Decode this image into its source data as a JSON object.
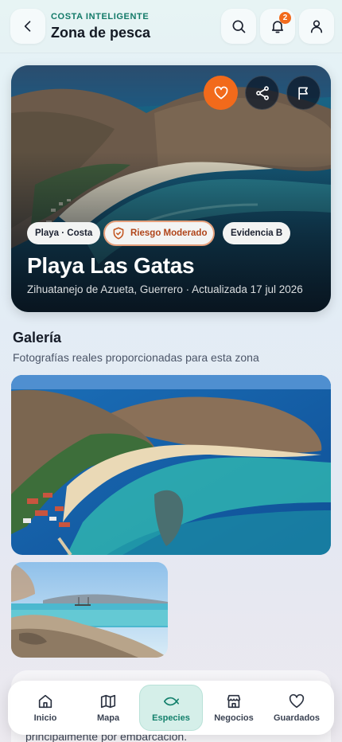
{
  "header": {
    "eyebrow": "COSTA INTELIGENTE",
    "title": "Zona de pesca",
    "notifications_count": "2",
    "icons": [
      "chevron-left-icon",
      "search-icon",
      "bell-icon",
      "user-icon"
    ]
  },
  "hero": {
    "chips": {
      "type": "Playa · Costa",
      "risk": "Riesgo Moderado",
      "evidence": "Evidencia B"
    },
    "title": "Playa Las Gatas",
    "subtitle": "Zihuatanejo de Azueta, Guerrero · Actualizada 17 jul 2026",
    "actions": [
      "heart-icon",
      "share-icon",
      "flag-icon"
    ]
  },
  "gallery": {
    "title": "Galería",
    "subtitle": "Fotografías reales proporcionadas para esta zona"
  },
  "peek": {
    "text": "principalmente por embarcación."
  },
  "nav": {
    "items": [
      {
        "label": "Inicio",
        "icon": "home-icon"
      },
      {
        "label": "Mapa",
        "icon": "map-icon"
      },
      {
        "label": "Especies",
        "icon": "fish-icon",
        "active": true
      },
      {
        "label": "Negocios",
        "icon": "store-icon"
      },
      {
        "label": "Guardados",
        "icon": "heart-icon"
      }
    ]
  },
  "colors": {
    "accent": "#13806c",
    "orange": "#f26a1b",
    "risk_text": "#b0451a"
  }
}
